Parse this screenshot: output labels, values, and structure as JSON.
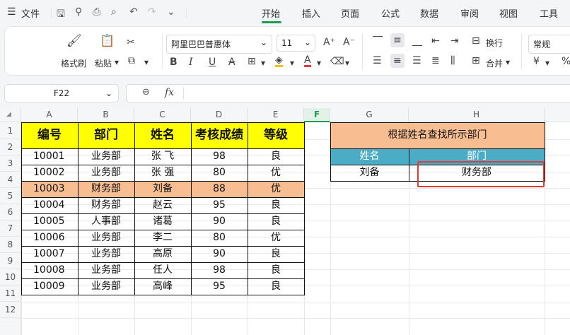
{
  "menu": {
    "file": "文件",
    "tabs": [
      "开始",
      "插入",
      "页面",
      "公式",
      "数据",
      "审阅",
      "视图",
      "工具"
    ],
    "active_tab": "开始"
  },
  "ribbon": {
    "format_painter": "格式刷",
    "paste": "粘贴",
    "font_name": "阿里巴巴普惠体",
    "font_size": "11",
    "wrap": "换行",
    "merge": "合并",
    "number_format": "常规",
    "currency": "¥",
    "percent": "%"
  },
  "formula_bar": {
    "name_box": "F22",
    "fx": "fx",
    "value": ""
  },
  "columns": [
    "A",
    "B",
    "C",
    "D",
    "E",
    "F",
    "G",
    "H"
  ],
  "rows": [
    "1",
    "2",
    "3",
    "4",
    "5",
    "6",
    "7",
    "8",
    "9",
    "10",
    "11",
    "12"
  ],
  "table": {
    "headers": [
      "编号",
      "部门",
      "姓名",
      "考核成绩",
      "等级"
    ],
    "rows": [
      [
        "10001",
        "业务部",
        "张 飞",
        "98",
        "良"
      ],
      [
        "10002",
        "业务部",
        "张 强",
        "80",
        "优"
      ],
      [
        "10003",
        "财务部",
        "刘备",
        "88",
        "优"
      ],
      [
        "10004",
        "财务部",
        "赵云",
        "95",
        "良"
      ],
      [
        "10005",
        "人事部",
        "诸葛",
        "90",
        "良"
      ],
      [
        "10006",
        "业务部",
        "李二",
        "80",
        "优"
      ],
      [
        "10007",
        "业务部",
        "高原",
        "90",
        "良"
      ],
      [
        "10008",
        "业务部",
        "任人",
        "98",
        "良"
      ],
      [
        "10009",
        "业务部",
        "高峰",
        "95",
        "良"
      ]
    ]
  },
  "lookup": {
    "title": "根据姓名查找所示部门",
    "h1": "姓名",
    "h2": "部门",
    "name": "刘备",
    "result": "财务部"
  },
  "colors": {
    "yellow": "#ffff00",
    "orange": "#f8bd91",
    "teal": "#4bacc6",
    "accent": "#1f9d55",
    "red_box": "#e53935"
  }
}
